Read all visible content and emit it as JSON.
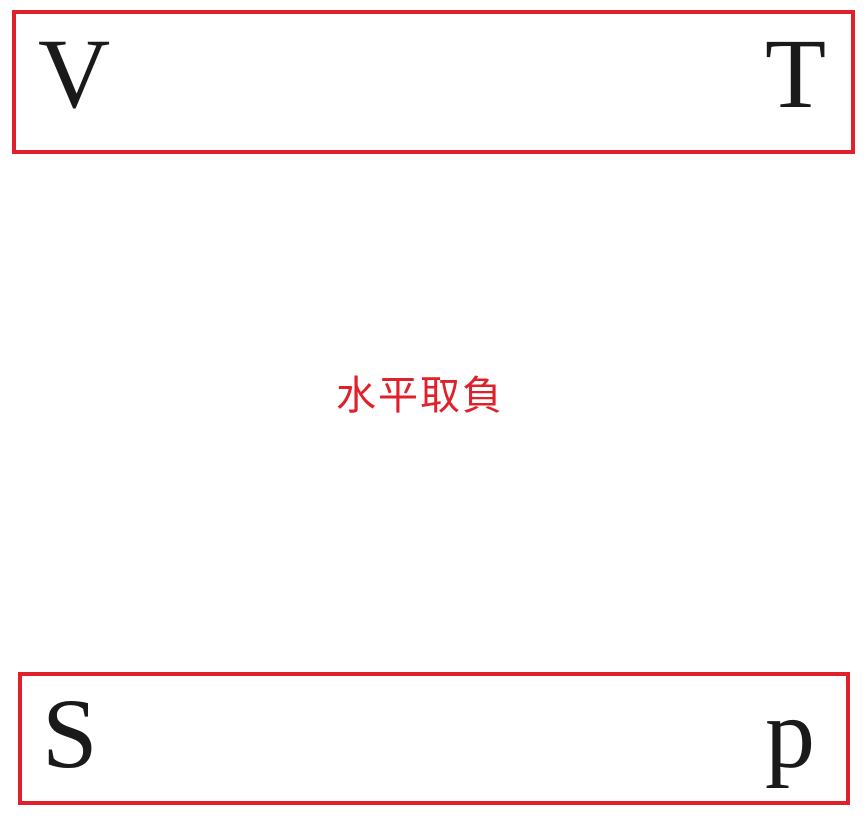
{
  "top_box": {
    "left_letter": "V",
    "right_letter": "T"
  },
  "bottom_box": {
    "left_letter": "S",
    "right_letter": "p"
  },
  "center_label": "水平取負",
  "colors": {
    "accent": "#e0202a",
    "text": "#1a1a1a",
    "background": "#ffffff"
  }
}
